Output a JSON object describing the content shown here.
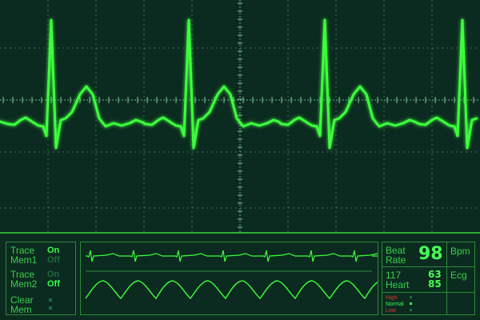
{
  "colors": {
    "background": "#0c2b20",
    "trace": "#3dff3d",
    "grid": "#4a8a6a",
    "text": "#35d14a",
    "dim": "#1b6b3f",
    "high": "#d23a2a",
    "normal": "#35ff4a",
    "low": "#d23a2a"
  },
  "controls": {
    "mem1": {
      "label_line1": "Trace",
      "label_line2": "Mem1",
      "on": "On",
      "off": "Off"
    },
    "mem2": {
      "label_line1": "Trace",
      "label_line2": "Mem2",
      "on": "On",
      "off": "Off"
    },
    "clear": {
      "label_line1": "Clear",
      "label_line2": "Mem"
    }
  },
  "vitals": {
    "beat_line1": "Beat",
    "beat_line2": "Rate",
    "beat_value": "98",
    "bpm_unit": "Bpm",
    "heart_value_left": "117",
    "heart_label": "Heart",
    "heart_value_top": "63",
    "heart_value_bottom": "85",
    "ecg_label": "Ecg",
    "legend_high": "High",
    "legend_normal": "Normal",
    "legend_low": "Low"
  }
}
